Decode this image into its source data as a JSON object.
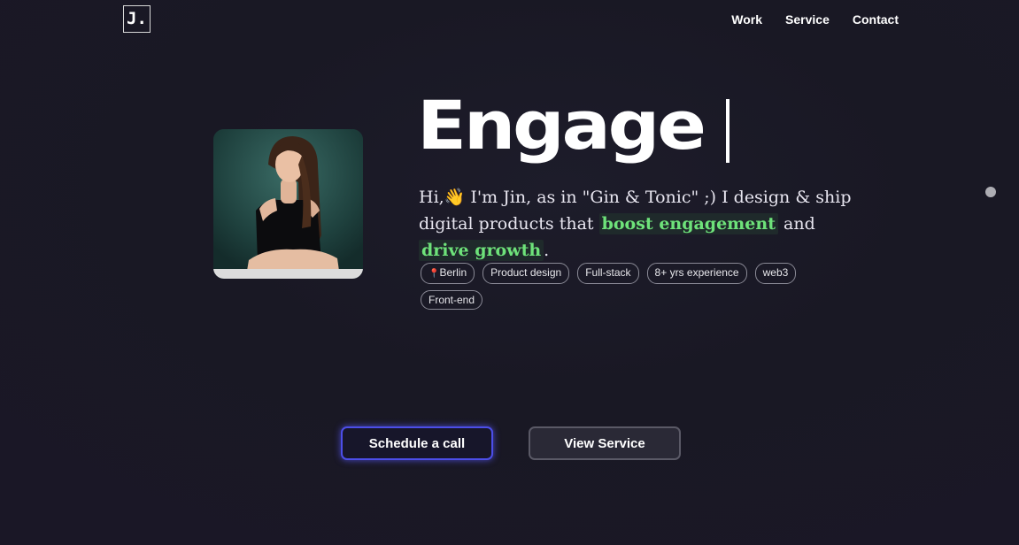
{
  "header": {
    "logo_text": "J.",
    "nav": [
      "Work",
      "Service",
      "Contact"
    ]
  },
  "hero": {
    "headline": "Engage",
    "intro": {
      "greeting": "Hi,",
      "wave_emoji": "👋",
      "part1": " I'm Jin, as in \"Gin & Tonic\" ;) I design & ship digital products that ",
      "highlight1": "boost engagement",
      "part2": " and ",
      "highlight2": "drive growth",
      "part3": "."
    },
    "tags": [
      "Berlin",
      "Product design",
      "Full-stack",
      "8+ yrs experience",
      "web3",
      "Front-end"
    ],
    "location_pin_emoji": "📍"
  },
  "cta": {
    "primary_label": "Schedule a call",
    "secondary_label": "View Service"
  },
  "colors": {
    "background": "#191824",
    "highlight_text": "#6ee27a",
    "primary_border": "#4c4ee8"
  }
}
